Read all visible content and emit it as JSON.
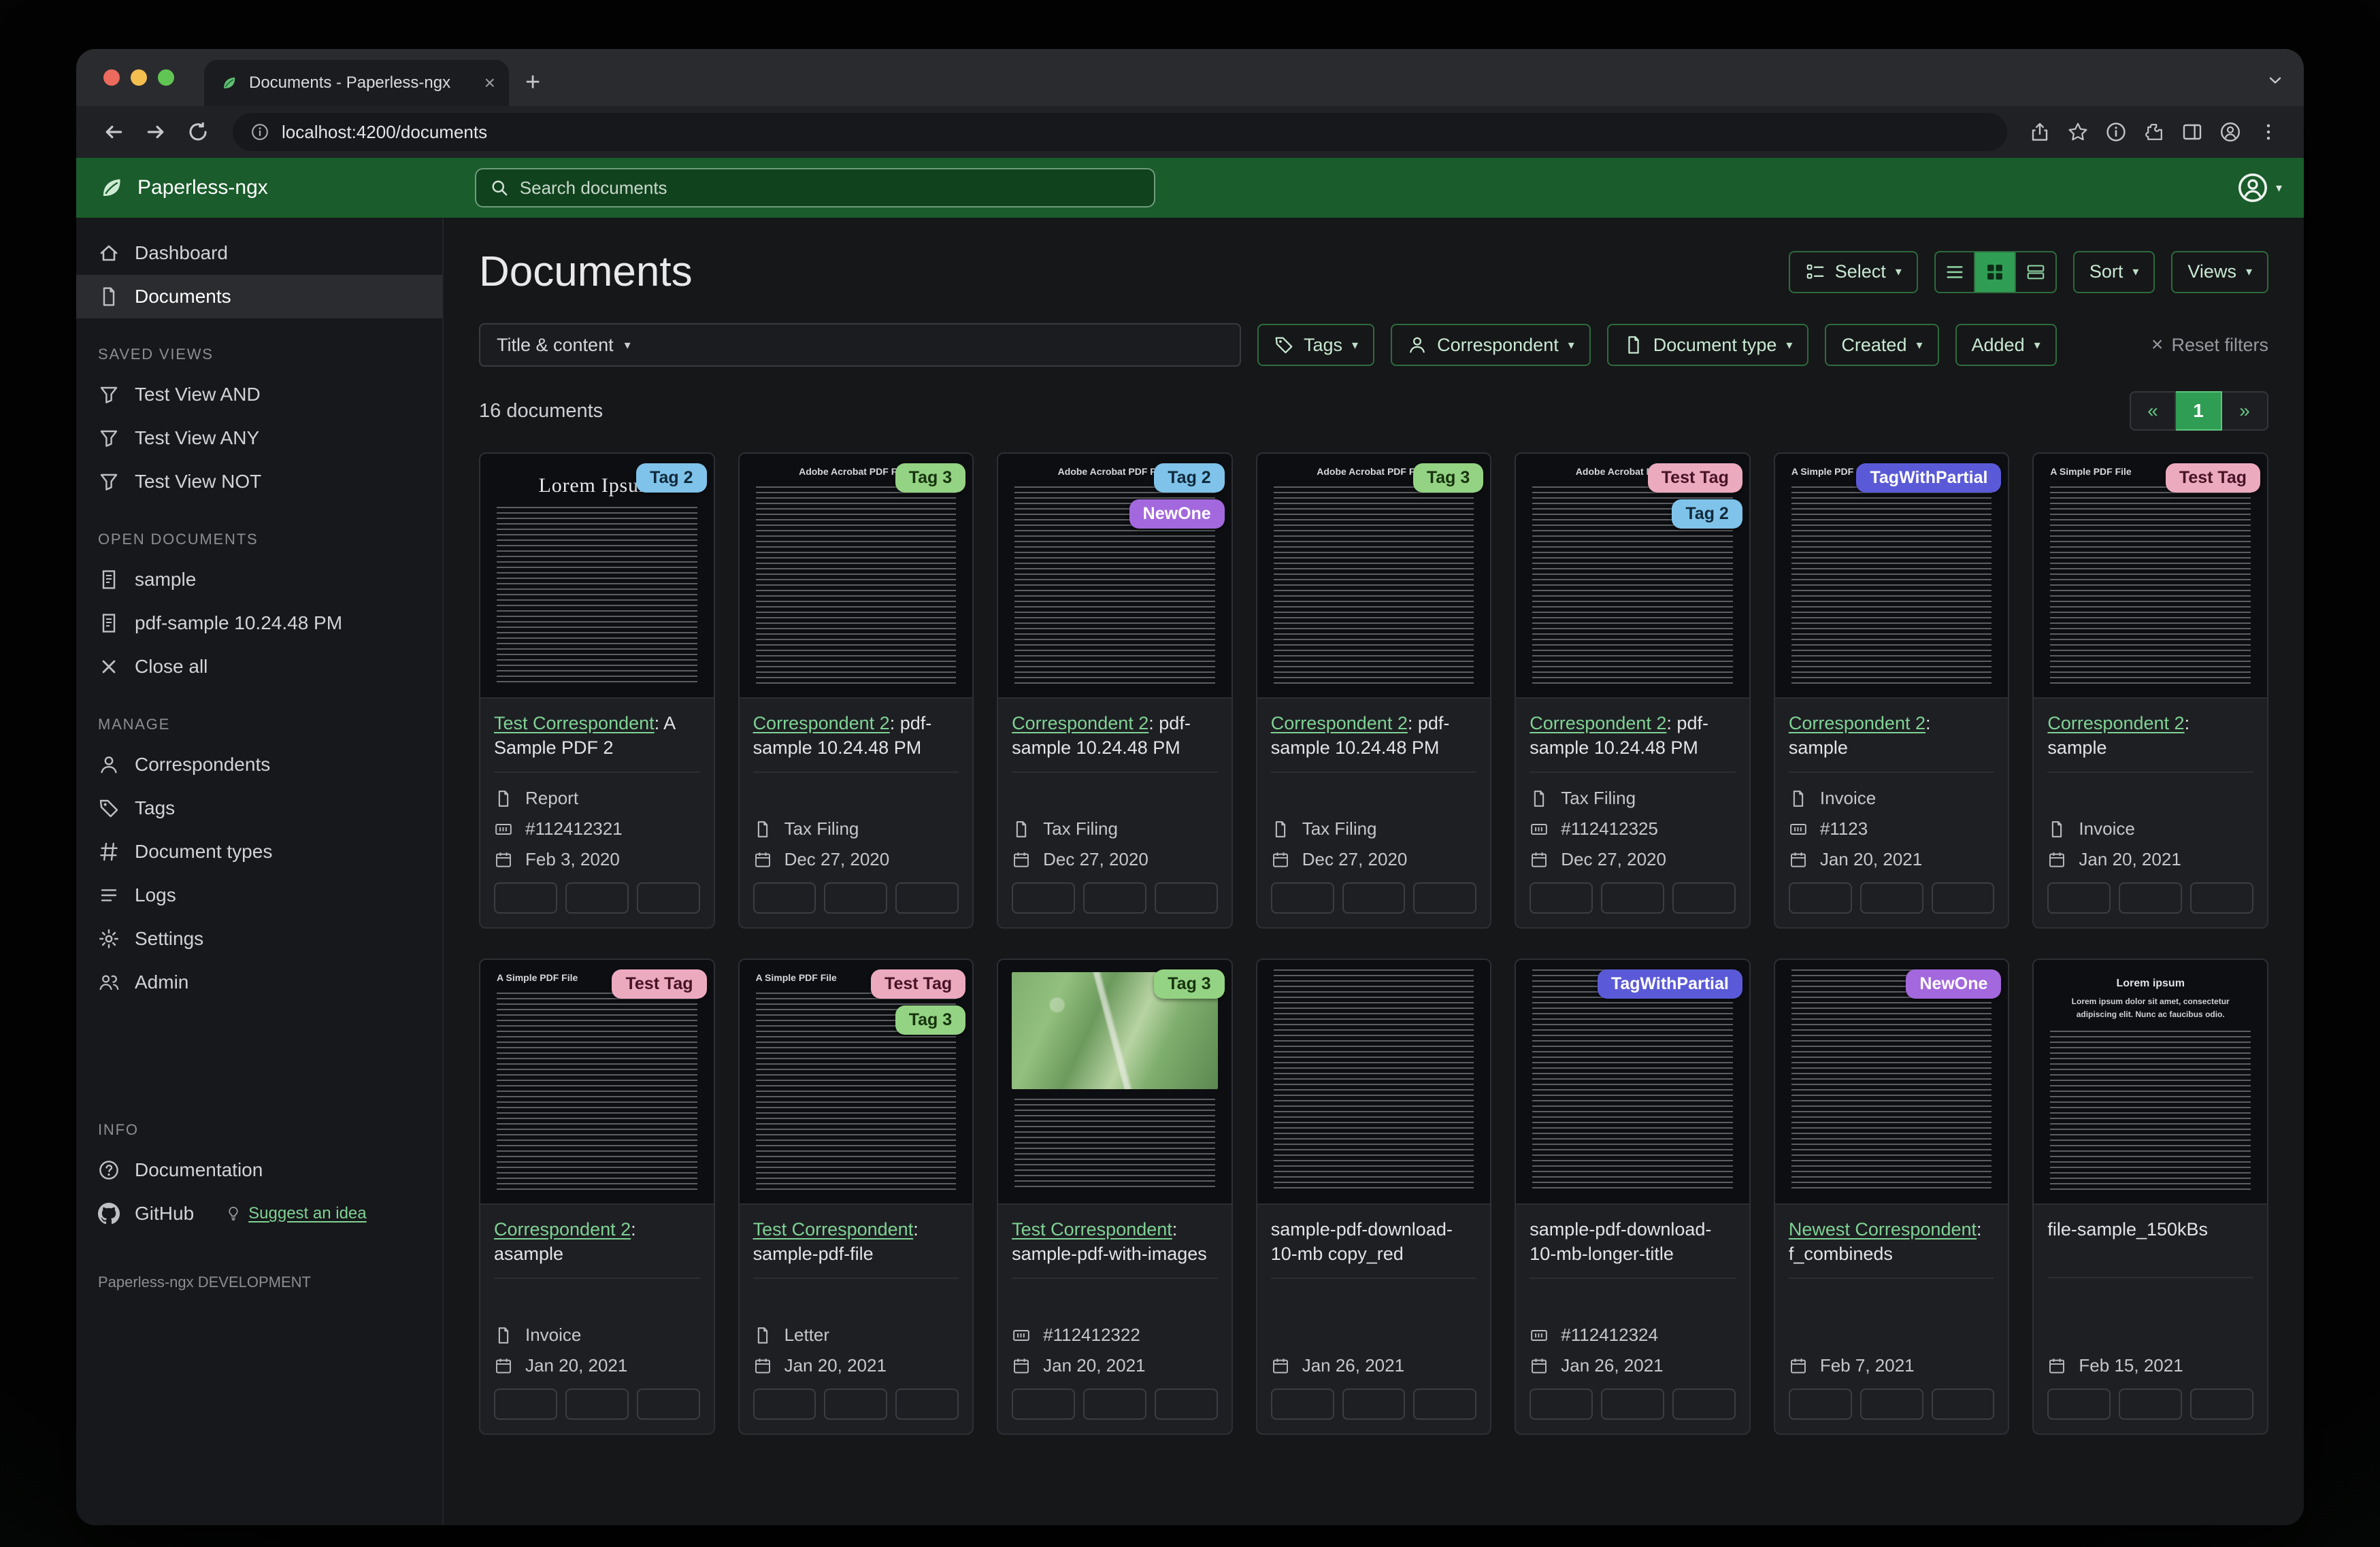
{
  "colors": {
    "header_green": "#1a5c2b",
    "accent_green": "#2f9e54",
    "link_green": "#7fd394"
  },
  "browser": {
    "tab_title": "Documents - Paperless-ngx",
    "url": "localhost:4200/documents"
  },
  "header": {
    "brand": "Paperless-ngx",
    "search_placeholder": "Search documents"
  },
  "sidebar": {
    "sections": [
      {
        "items": [
          {
            "icon": "home",
            "label": "Dashboard"
          },
          {
            "icon": "file",
            "label": "Documents",
            "active": true
          }
        ]
      },
      {
        "title": "SAVED VIEWS",
        "items": [
          {
            "icon": "funnel",
            "label": "Test View AND"
          },
          {
            "icon": "funnel",
            "label": "Test View ANY"
          },
          {
            "icon": "funnel",
            "label": "Test View NOT"
          }
        ]
      },
      {
        "title": "OPEN DOCUMENTS",
        "items": [
          {
            "icon": "doc",
            "label": "sample"
          },
          {
            "icon": "doc",
            "label": "pdf-sample 10.24.48 PM"
          },
          {
            "icon": "close",
            "label": "Close all"
          }
        ]
      },
      {
        "title": "MANAGE",
        "items": [
          {
            "icon": "person",
            "label": "Correspondents"
          },
          {
            "icon": "tag",
            "label": "Tags"
          },
          {
            "icon": "hash",
            "label": "Document types"
          },
          {
            "icon": "list",
            "label": "Logs"
          },
          {
            "icon": "gear",
            "label": "Settings"
          },
          {
            "icon": "people",
            "label": "Admin"
          }
        ]
      },
      {
        "title": "INFO",
        "items": [
          {
            "icon": "question",
            "label": "Documentation"
          },
          {
            "icon": "github",
            "label": "GitHub",
            "link": "Suggest an idea"
          }
        ]
      }
    ],
    "footer": "Paperless-ngx DEVELOPMENT"
  },
  "main": {
    "title": "Documents",
    "count": "16 documents",
    "toolbar": {
      "select": "Select",
      "sort": "Sort",
      "views": "Views"
    },
    "filters": {
      "field": "Title & content",
      "buttons": [
        {
          "icon": "tag",
          "label": "Tags"
        },
        {
          "icon": "person",
          "label": "Correspondent"
        },
        {
          "icon": "file",
          "label": "Document type"
        },
        {
          "label": "Created"
        },
        {
          "label": "Added"
        }
      ],
      "reset": "Reset filters"
    },
    "pagination": {
      "prev": "«",
      "current": "1",
      "next": "»"
    }
  },
  "cards": [
    {
      "thumb": "lorem-serif",
      "thumb_title": "Lorem Ipsum",
      "tags": [
        {
          "label": "Tag 2",
          "bg": "#7fc3ea",
          "fg": "#10293b"
        }
      ],
      "link": "Test Correspondent",
      "rest": ": A Sample PDF 2",
      "type": "Report",
      "asn": "#112412321",
      "date": "Feb 3, 2020"
    },
    {
      "thumb": "acrobat",
      "thumb_title": "Adobe Acrobat PDF Files",
      "tags": [
        {
          "label": "Tag 3",
          "bg": "#94d383",
          "fg": "#17330e"
        }
      ],
      "link": "Correspondent 2",
      "rest": ": pdf-sample 10.24.48 PM",
      "type": "Tax Filing",
      "date": "Dec 27, 2020"
    },
    {
      "thumb": "acrobat",
      "thumb_title": "Adobe Acrobat PDF Files",
      "tags": [
        {
          "label": "Tag 2",
          "bg": "#7fc3ea",
          "fg": "#10293b"
        },
        {
          "label": "NewOne",
          "bg": "#a368dd",
          "fg": "#ffffff"
        }
      ],
      "link": "Correspondent 2",
      "rest": ": pdf-sample 10.24.48 PM",
      "type": "Tax Filing",
      "date": "Dec 27, 2020"
    },
    {
      "thumb": "acrobat",
      "thumb_title": "Adobe Acrobat PDF Files",
      "tags": [
        {
          "label": "Tag 3",
          "bg": "#94d383",
          "fg": "#17330e"
        }
      ],
      "link": "Correspondent 2",
      "rest": ": pdf-sample 10.24.48 PM",
      "type": "Tax Filing",
      "date": "Dec 27, 2020"
    },
    {
      "thumb": "acrobat",
      "thumb_title": "Adobe Acrobat PDF Files",
      "tags": [
        {
          "label": "Test Tag",
          "bg": "#ecaabf",
          "fg": "#471326"
        },
        {
          "label": "Tag 2",
          "bg": "#7fc3ea",
          "fg": "#10293b"
        }
      ],
      "link": "Correspondent 2",
      "rest": ": pdf-sample 10.24.48 PM",
      "type": "Tax Filing",
      "asn": "#112412325",
      "date": "Dec 27, 2020"
    },
    {
      "thumb": "simple",
      "thumb_title": "A Simple PDF File",
      "tags": [
        {
          "label": "TagWithPartial",
          "bg": "#5a5ad8",
          "fg": "#ffffff"
        }
      ],
      "link": "Correspondent 2",
      "rest": ": sample",
      "type": "Invoice",
      "asn": "#1123",
      "date": "Jan 20, 2021"
    },
    {
      "thumb": "simple",
      "thumb_title": "A Simple PDF File",
      "tags": [
        {
          "label": "Test Tag",
          "bg": "#ecaabf",
          "fg": "#471326"
        }
      ],
      "link": "Correspondent 2",
      "rest": ": sample",
      "type": "Invoice",
      "date": "Jan 20, 2021"
    },
    {
      "thumb": "simple",
      "thumb_title": "A Simple PDF File",
      "tags": [
        {
          "label": "Test Tag",
          "bg": "#ecaabf",
          "fg": "#471326"
        }
      ],
      "link": "Correspondent 2",
      "rest": ": asample",
      "type": "Invoice",
      "date": "Jan 20, 2021"
    },
    {
      "thumb": "simple",
      "thumb_title": "A Simple PDF File",
      "tags": [
        {
          "label": "Test Tag",
          "bg": "#ecaabf",
          "fg": "#471326"
        },
        {
          "label": "Tag 3",
          "bg": "#94d383",
          "fg": "#17330e"
        }
      ],
      "link": "Test Correspondent",
      "rest": ": sample-pdf-file",
      "type": "Letter",
      "date": "Jan 20, 2021"
    },
    {
      "thumb": "map",
      "tags": [
        {
          "label": "Tag 3",
          "bg": "#94d383",
          "fg": "#17330e"
        }
      ],
      "link": "Test Correspondent",
      "rest": ": sample-pdf-with-images",
      "asn": "#112412322",
      "date": "Jan 20, 2021"
    },
    {
      "thumb": "dense",
      "tags": [],
      "rest": "sample-pdf-download-10-mb copy_red",
      "date": "Jan 26, 2021"
    },
    {
      "thumb": "dense",
      "tags": [
        {
          "label": "TagWithPartial",
          "bg": "#5a5ad8",
          "fg": "#ffffff"
        }
      ],
      "rest": "sample-pdf-download-10-mb-longer-title",
      "asn": "#112412324",
      "date": "Jan 26, 2021"
    },
    {
      "thumb": "dense",
      "tags": [
        {
          "label": "NewOne",
          "bg": "#a368dd",
          "fg": "#ffffff"
        }
      ],
      "link": "Newest Correspondent",
      "rest": ": f_combineds",
      "date": "Feb 7, 2021"
    },
    {
      "thumb": "lorem-center",
      "thumb_title": "Lorem ipsum",
      "thumb_sub": "Lorem ipsum dolor sit amet, consectetur adipiscing elit. Nunc ac faucibus odio.",
      "tags": [],
      "rest": "file-sample_150kBs",
      "date": "Feb 15, 2021"
    }
  ]
}
